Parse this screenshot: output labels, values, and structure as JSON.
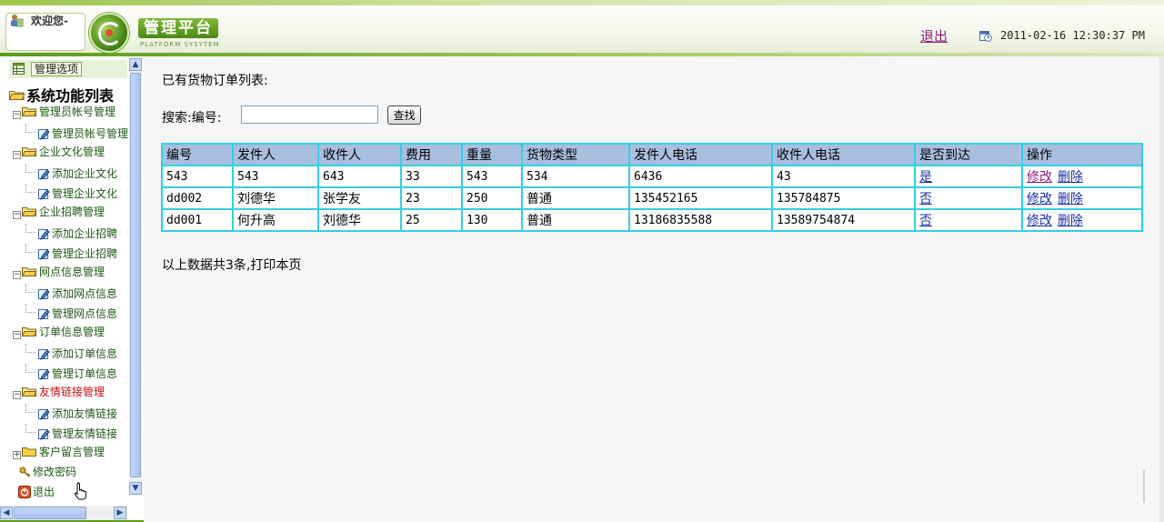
{
  "header": {
    "welcome": "欢迎您-",
    "logo_title": "管理平台",
    "logo_subtitle": "PLATFORM SYSYTEM",
    "logout": "退出",
    "datetime": "2011-02-16 12:30:37 PM"
  },
  "sidebar": {
    "head_label": "管理选项",
    "root": "系统功能列表",
    "nodes": [
      {
        "label": "管理员帐号管理",
        "children": [
          "管理员帐号管理"
        ]
      },
      {
        "label": "企业文化管理",
        "children": [
          "添加企业文化",
          "管理企业文化"
        ]
      },
      {
        "label": "企业招聘管理",
        "children": [
          "添加企业招聘",
          "管理企业招聘"
        ]
      },
      {
        "label": "网点信息管理",
        "children": [
          "添加网点信息",
          "管理网点信息"
        ]
      },
      {
        "label": "订单信息管理",
        "children": [
          "添加订单信息",
          "管理订单信息"
        ]
      },
      {
        "label": "友情链接管理",
        "children": [
          "添加友情链接",
          "管理友情链接"
        ]
      },
      {
        "label": "客户留言管理",
        "children": []
      }
    ],
    "extra": [
      "修改密码",
      "退出"
    ]
  },
  "main": {
    "heading": "已有货物订单列表:",
    "search_label": "搜索:编号:",
    "search_value": "",
    "search_button": "查找",
    "columns": [
      "编号",
      "发件人",
      "收件人",
      "费用",
      "重量",
      "货物类型",
      "发件人电话",
      "收件人电话",
      "是否到达",
      "操作"
    ],
    "rows": [
      [
        "543",
        "543",
        "643",
        "33",
        "543",
        "534",
        "6436",
        "43",
        "是"
      ],
      [
        "dd002",
        "刘德华",
        "张学友",
        "23",
        "250",
        "普通",
        "135452165",
        "135784875",
        "否"
      ],
      [
        "dd001",
        "何升高",
        "刘德华",
        "25",
        "130",
        "普通",
        "13186835588",
        "13589754874",
        "否"
      ]
    ],
    "action_edit": "修改",
    "action_delete": "删除",
    "footer": "以上数据共3条,打印本页"
  }
}
